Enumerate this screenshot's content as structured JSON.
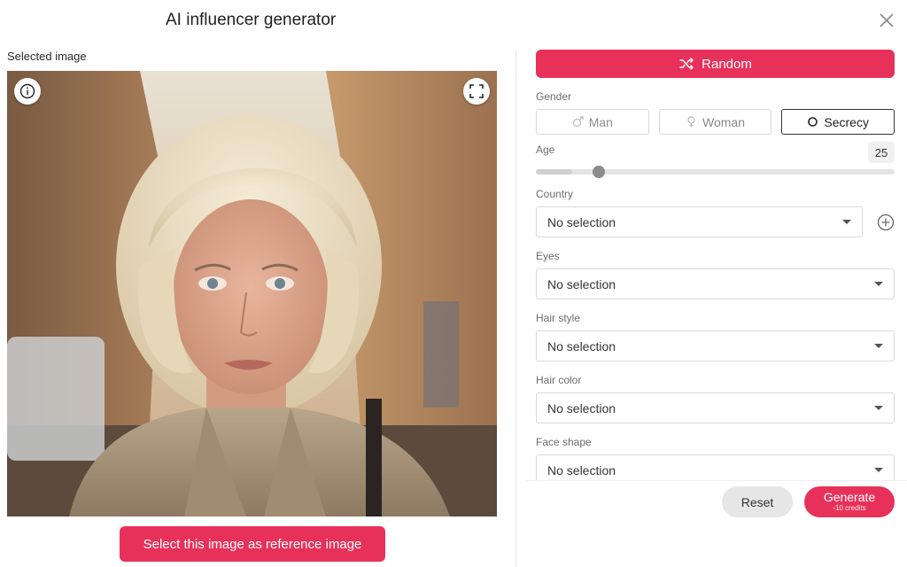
{
  "dialog": {
    "title": "AI influencer generator",
    "close_icon": "close-icon"
  },
  "left": {
    "selected_label": "Selected image",
    "image_alt": "Generated portrait",
    "reference_button": "Select this image as reference image"
  },
  "panel": {
    "random_label": "Random",
    "gender": {
      "label": "Gender",
      "options": [
        {
          "label": "Man",
          "icon": "male-icon",
          "active": false
        },
        {
          "label": "Woman",
          "icon": "female-icon",
          "active": false
        },
        {
          "label": "Secrecy",
          "icon": "circle-icon",
          "active": true
        }
      ]
    },
    "age": {
      "label": "Age",
      "value": "25",
      "fraction": 0.1
    },
    "country": {
      "label": "Country",
      "value": "No selection"
    },
    "eyes": {
      "label": "Eyes",
      "value": "No selection"
    },
    "hair_style": {
      "label": "Hair style",
      "value": "No selection"
    },
    "hair_color": {
      "label": "Hair color",
      "value": "No selection"
    },
    "face_shape": {
      "label": "Face shape",
      "value": "No selection"
    }
  },
  "footer": {
    "reset_label": "Reset",
    "generate_label": "Generate",
    "generate_cost": "-10 credits"
  },
  "colors": {
    "accent": "#e8315a",
    "border": "#d9d9d9",
    "muted": "#6b6b6b"
  }
}
